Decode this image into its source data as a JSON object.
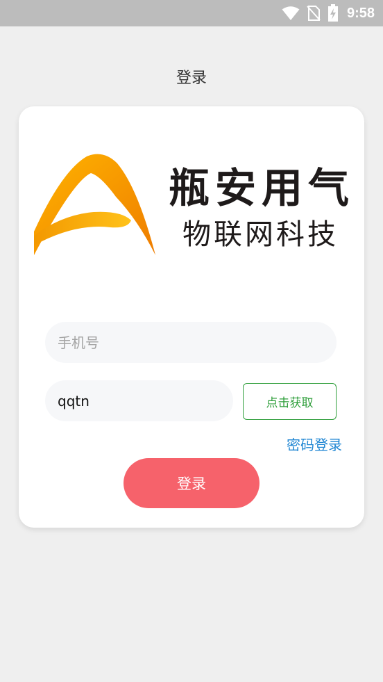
{
  "status_bar": {
    "time": "9:58",
    "icons": [
      "wifi-icon",
      "no-sim-icon",
      "battery-charging-icon"
    ]
  },
  "header": {
    "title": "登录"
  },
  "logo": {
    "line1": "瓶安用气",
    "line2": "物联网科技",
    "colors": [
      "#f7a600",
      "#f08300"
    ]
  },
  "form": {
    "phone": {
      "placeholder": "手机号",
      "value": ""
    },
    "code": {
      "placeholder": "",
      "value": "qqtn"
    },
    "get_code_label": "点击获取",
    "password_login_label": "密码登录",
    "login_label": "登录"
  },
  "colors": {
    "background": "#efefef",
    "accent_login": "#f6626b",
    "code_button": "#2e9e3a",
    "link": "#1f86d3"
  }
}
